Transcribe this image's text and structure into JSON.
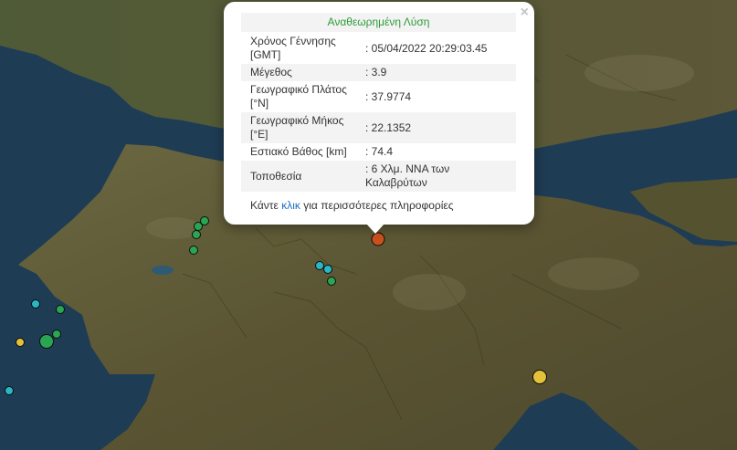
{
  "popup": {
    "title": "Αναθεωρημένη Λύση",
    "close_label": "×",
    "rows": [
      {
        "label": "Χρόνος Γέννησης [GMT]",
        "value": ": 05/04/2022 20:29:03.45"
      },
      {
        "label": "Μέγεθος",
        "value": ": 3.9"
      },
      {
        "label": "Γεωγραφικό Πλάτος [°N]",
        "value": ": 37.9774"
      },
      {
        "label": "Γεωγραφικό Μήκος [°E]",
        "value": ": 22.1352"
      },
      {
        "label": "Εστιακό Βάθος [km]",
        "value": ": 74.4"
      },
      {
        "label": "Τοποθεσία",
        "value": ": 6 Χλμ. ΝΝΑ των Καλαβρύτων"
      }
    ],
    "footer_pre": "Κάντε",
    "footer_link": "κλικ",
    "footer_post": "για περισσότερες πληροφορίες"
  },
  "colors": {
    "sea": "#1f3c55",
    "land": "#5e5a37",
    "selected_event": "#c9511d",
    "event_green": "#2aa652",
    "event_cyan": "#29b7c6",
    "event_yellow": "#e3c23a"
  },
  "map": {
    "basemap": "satellite",
    "selected_marker": "selected-earthquake-marker",
    "marker_colors": [
      "event_green",
      "event_cyan",
      "event_yellow",
      "selected_event"
    ]
  }
}
